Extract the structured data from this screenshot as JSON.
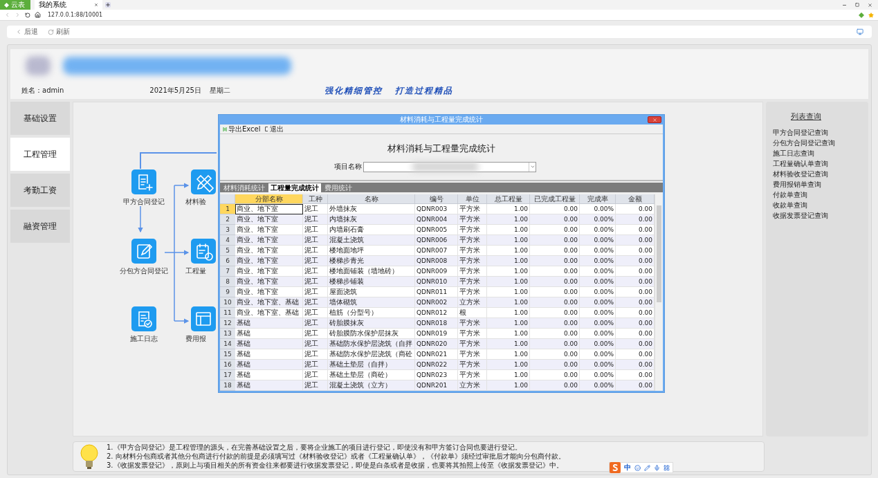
{
  "browser": {
    "app_button": "云表",
    "tab": "我的系统",
    "url": "127.0.0.1:88/10001"
  },
  "toolbar": {
    "buttons": [
      "后退",
      "刷新"
    ]
  },
  "header": {
    "user": "姓名：admin",
    "date": "2021年5月25日",
    "weekday": "星期二",
    "slogan": "强化精细管控   打造过程精品"
  },
  "nav": [
    {
      "label": "基础设置",
      "selected": false
    },
    {
      "label": "工程管理",
      "selected": true
    },
    {
      "label": "考勤工资",
      "selected": false
    },
    {
      "label": "融资管理",
      "selected": false
    }
  ],
  "flow": {
    "nodes": [
      {
        "label": "甲方合同登记",
        "kind": "add-doc"
      },
      {
        "label": "分包方合同登记",
        "kind": "edit"
      },
      {
        "label": "施工日志",
        "kind": "check-doc"
      },
      {
        "label": "材料验",
        "kind": "ruler"
      },
      {
        "label": "工程量",
        "kind": "calendar"
      },
      {
        "label": "费用报",
        "kind": "window"
      }
    ]
  },
  "query_panel": {
    "title": "列表查询",
    "items": [
      "甲方合同登记查询",
      "分包方合同登记查询",
      "施工日志查询",
      "工程量确认单查询",
      "材料验收登记查询",
      "费用报销单查询",
      "付款单查询",
      "收款单查询",
      "收据发票登记查询"
    ]
  },
  "tips": [
    "1.《甲方合同登记》是工程管理的源头，在完善基础设置之后，要将企业施工的项目进行登记，即使没有和甲方签订合同也要进行登记。",
    "2. 向材料分包商或者其他分包商进行付款的前提是必须填写过《材料验收登记》或者《工程量确认单》，《付款单》须经过审批后才能向分包商付款。",
    "3.《收据发票登记》，原则上与项目相关的所有资金往来都要进行收据发票登记，即使是白条或者是收据，也要将其拍照上传至《收据发票登记》中。"
  ],
  "ime": {
    "mode": "中"
  },
  "dialog": {
    "title": "材料消耗与工程量完成统计",
    "actions": [
      "导出Excel",
      "退出"
    ],
    "heading": "材料消耗与工程量完成统计",
    "project_label": "项目名称",
    "tabs": [
      {
        "label": "材料消耗统计",
        "selected": false
      },
      {
        "label": "工程量完成统计",
        "selected": true
      },
      {
        "label": "费用统计",
        "selected": false
      }
    ],
    "table": {
      "columns": [
        {
          "label": "分部名称",
          "selected": true
        },
        {
          "label": "工种",
          "selected": false
        },
        {
          "label": "名称",
          "selected": false
        },
        {
          "label": "编号",
          "selected": false
        },
        {
          "label": "单位",
          "selected": false
        },
        {
          "label": "总工程量",
          "selected": false
        },
        {
          "label": "已完成工程量",
          "selected": false
        },
        {
          "label": "完成率",
          "selected": false
        },
        {
          "label": "金额",
          "selected": false
        }
      ],
      "rows": [
        {
          "no": "1",
          "selected": true,
          "cells": [
            "商业、地下室",
            "泥工",
            "外墙抹灰",
            "QDNR003",
            "平方米",
            "1.00",
            "0.00",
            "0.00%",
            "0.00"
          ]
        },
        {
          "no": "2",
          "selected": false,
          "cells": [
            "商业、地下室",
            "泥工",
            "内墙抹灰",
            "QDNR004",
            "平方米",
            "1.00",
            "0.00",
            "0.00%",
            "0.00"
          ]
        },
        {
          "no": "3",
          "selected": false,
          "cells": [
            "商业、地下室",
            "泥工",
            "内墙刷石膏",
            "QDNR005",
            "平方米",
            "1.00",
            "0.00",
            "0.00%",
            "0.00"
          ]
        },
        {
          "no": "4",
          "selected": false,
          "cells": [
            "商业、地下室",
            "泥工",
            "混凝土浇筑",
            "QDNR006",
            "平方米",
            "1.00",
            "0.00",
            "0.00%",
            "0.00"
          ]
        },
        {
          "no": "5",
          "selected": false,
          "cells": [
            "商业、地下室",
            "泥工",
            "楼地面地坪",
            "QDNR007",
            "平方米",
            "1.00",
            "0.00",
            "0.00%",
            "0.00"
          ]
        },
        {
          "no": "6",
          "selected": false,
          "cells": [
            "商业、地下室",
            "泥工",
            "楼梯步青光",
            "QDNR008",
            "平方米",
            "1.00",
            "0.00",
            "0.00%",
            "0.00"
          ]
        },
        {
          "no": "7",
          "selected": false,
          "cells": [
            "商业、地下室",
            "泥工",
            "楼地面铺装（墙地砖）",
            "QDNR009",
            "平方米",
            "1.00",
            "0.00",
            "0.00%",
            "0.00"
          ]
        },
        {
          "no": "8",
          "selected": false,
          "cells": [
            "商业、地下室",
            "泥工",
            "楼梯步铺装",
            "QDNR010",
            "平方米",
            "1.00",
            "0.00",
            "0.00%",
            "0.00"
          ]
        },
        {
          "no": "9",
          "selected": false,
          "cells": [
            "商业、地下室",
            "泥工",
            "屋面浇筑",
            "QDNR011",
            "平方米",
            "1.00",
            "0.00",
            "0.00%",
            "0.00"
          ]
        },
        {
          "no": "10",
          "selected": false,
          "cells": [
            "商业、地下室、基础",
            "泥工",
            "墙体砌筑",
            "QDNR002",
            "立方米",
            "1.00",
            "0.00",
            "0.00%",
            "0.00"
          ]
        },
        {
          "no": "11",
          "selected": false,
          "cells": [
            "商业、地下室、基础",
            "泥工",
            "植筋（分型号）",
            "QDNR012",
            "根",
            "1.00",
            "0.00",
            "0.00%",
            "0.00"
          ]
        },
        {
          "no": "12",
          "selected": false,
          "cells": [
            "基础",
            "泥工",
            "砖胎膜抹灰",
            "QDNR018",
            "平方米",
            "1.00",
            "0.00",
            "0.00%",
            "0.00"
          ]
        },
        {
          "no": "13",
          "selected": false,
          "cells": [
            "基础",
            "泥工",
            "砖胎膜防水保护层抹灰",
            "QDNR019",
            "平方米",
            "1.00",
            "0.00",
            "0.00%",
            "0.00"
          ]
        },
        {
          "no": "14",
          "selected": false,
          "cells": [
            "基础",
            "泥工",
            "基础防水保护层浇筑（自拌",
            "QDNR020",
            "平方米",
            "1.00",
            "0.00",
            "0.00%",
            "0.00"
          ]
        },
        {
          "no": "15",
          "selected": false,
          "cells": [
            "基础",
            "泥工",
            "基础防水保护层浇筑（商砼",
            "QDNR021",
            "平方米",
            "1.00",
            "0.00",
            "0.00%",
            "0.00"
          ]
        },
        {
          "no": "16",
          "selected": false,
          "cells": [
            "基础",
            "泥工",
            "基础土垫层（自拌）",
            "QDNR022",
            "平方米",
            "1.00",
            "0.00",
            "0.00%",
            "0.00"
          ]
        },
        {
          "no": "17",
          "selected": false,
          "cells": [
            "基础",
            "泥工",
            "基础土垫层（商砼）",
            "QDNR023",
            "平方米",
            "1.00",
            "0.00",
            "0.00%",
            "0.00"
          ]
        },
        {
          "no": "18",
          "selected": false,
          "cells": [
            "基础",
            "泥工",
            "混凝土浇筑（立方）",
            "QDNR201",
            "立方米",
            "1.00",
            "0.00",
            "0.00%",
            "0.00"
          ]
        }
      ]
    }
  }
}
